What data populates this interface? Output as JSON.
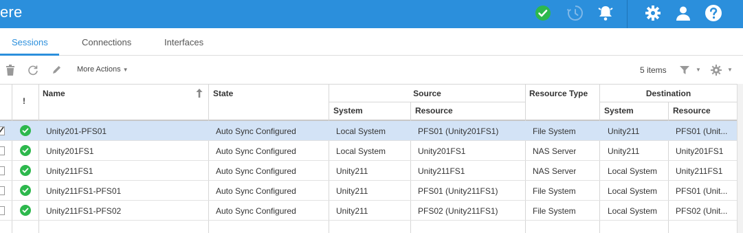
{
  "header": {
    "title": "ere",
    "icons": [
      "status-ok-icon",
      "history-icon",
      "bell-icon",
      "gear-icon",
      "user-icon",
      "help-icon"
    ],
    "colors": {
      "bar": "#2b8fdc",
      "ok": "#2db84d"
    }
  },
  "tabs": [
    {
      "label": "Sessions",
      "active": true
    },
    {
      "label": "Connections",
      "active": false
    },
    {
      "label": "Interfaces",
      "active": false
    }
  ],
  "toolbar": {
    "icons": [
      "trash-icon",
      "refresh-icon",
      "edit-icon",
      "filter-icon",
      "settings-icon"
    ],
    "more_actions_label": "More Actions",
    "item_count": "5 items"
  },
  "table": {
    "columns": {
      "status": "!",
      "name": "Name",
      "state": "State",
      "source": "Source",
      "source_system": "System",
      "source_resource": "Resource",
      "resource_type": "Resource Type",
      "destination": "Destination",
      "dest_system": "System",
      "dest_resource": "Resource"
    },
    "sort": "name-ascending",
    "rows": [
      {
        "selected": true,
        "name": "Unity201-PFS01",
        "state": "Auto Sync Configured",
        "src_system": "Local System",
        "src_resource": "PFS01 (Unity201FS1)",
        "resource_type": "File System",
        "dst_system": "Unity211",
        "dst_resource": "PFS01 (Unit..."
      },
      {
        "selected": false,
        "name": "Unity201FS1",
        "state": "Auto Sync Configured",
        "src_system": "Local System",
        "src_resource": "Unity201FS1",
        "resource_type": "NAS Server",
        "dst_system": "Unity211",
        "dst_resource": "Unity201FS1"
      },
      {
        "selected": false,
        "name": "Unity211FS1",
        "state": "Auto Sync Configured",
        "src_system": "Unity211",
        "src_resource": "Unity211FS1",
        "resource_type": "NAS Server",
        "dst_system": "Local System",
        "dst_resource": "Unity211FS1"
      },
      {
        "selected": false,
        "name": "Unity211FS1-PFS01",
        "state": "Auto Sync Configured",
        "src_system": "Unity211",
        "src_resource": "PFS01 (Unity211FS1)",
        "resource_type": "File System",
        "dst_system": "Local System",
        "dst_resource": "PFS01 (Unit..."
      },
      {
        "selected": false,
        "name": "Unity211FS1-PFS02",
        "state": "Auto Sync Configured",
        "src_system": "Unity211",
        "src_resource": "PFS02 (Unity211FS1)",
        "resource_type": "File System",
        "dst_system": "Local System",
        "dst_resource": "PFS02 (Unit..."
      }
    ]
  }
}
